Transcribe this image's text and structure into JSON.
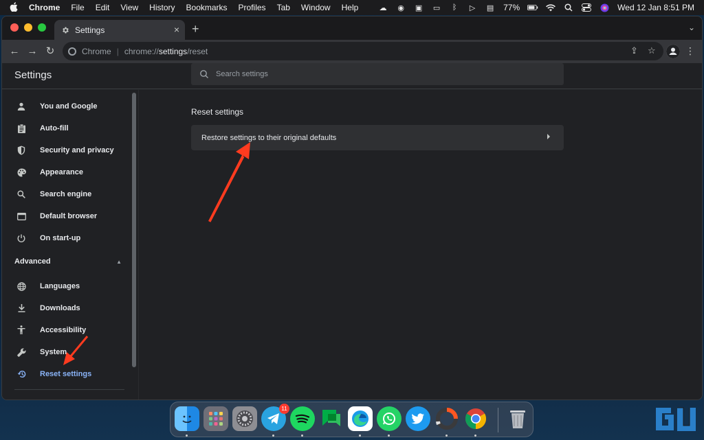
{
  "menubar": {
    "app_name": "Chrome",
    "menus": [
      "File",
      "Edit",
      "View",
      "History",
      "Bookmarks",
      "Profiles",
      "Tab",
      "Window",
      "Help"
    ],
    "battery": "77%",
    "clock": "Wed 12 Jan  8:51 PM"
  },
  "browser": {
    "tab_title": "Settings",
    "omnibox": {
      "site_label": "Chrome",
      "url_prefix": "chrome://",
      "url_host": "settings",
      "url_path": "/reset"
    }
  },
  "settings": {
    "title": "Settings",
    "search_placeholder": "Search settings",
    "nav": [
      {
        "label": "You and Google",
        "icon": "person-icon"
      },
      {
        "label": "Auto-fill",
        "icon": "clipboard-icon"
      },
      {
        "label": "Security and privacy",
        "icon": "shield-icon"
      },
      {
        "label": "Appearance",
        "icon": "palette-icon"
      },
      {
        "label": "Search engine",
        "icon": "search-icon"
      },
      {
        "label": "Default browser",
        "icon": "browser-icon"
      },
      {
        "label": "On start-up",
        "icon": "power-icon"
      }
    ],
    "advanced_label": "Advanced",
    "advanced_nav": [
      {
        "label": "Languages",
        "icon": "globe-icon"
      },
      {
        "label": "Downloads",
        "icon": "download-icon"
      },
      {
        "label": "Accessibility",
        "icon": "accessibility-icon"
      },
      {
        "label": "System",
        "icon": "wrench-icon"
      },
      {
        "label": "Reset settings",
        "icon": "history-icon",
        "active": true
      }
    ],
    "section_title": "Reset settings",
    "restore_label": "Restore settings to their original defaults"
  },
  "dock": {
    "apps": [
      "Finder",
      "Launchpad",
      "System Preferences",
      "Telegram",
      "Spotify",
      "Google Chat",
      "Microsoft Edge",
      "WhatsApp",
      "Twitter",
      "Screen Recorder",
      "Google Chrome",
      "Trash"
    ],
    "telegram_badge": "11"
  },
  "colors": {
    "accent": "#8ab4f8",
    "annotation": "#ff3b1f",
    "background": "#202124"
  }
}
